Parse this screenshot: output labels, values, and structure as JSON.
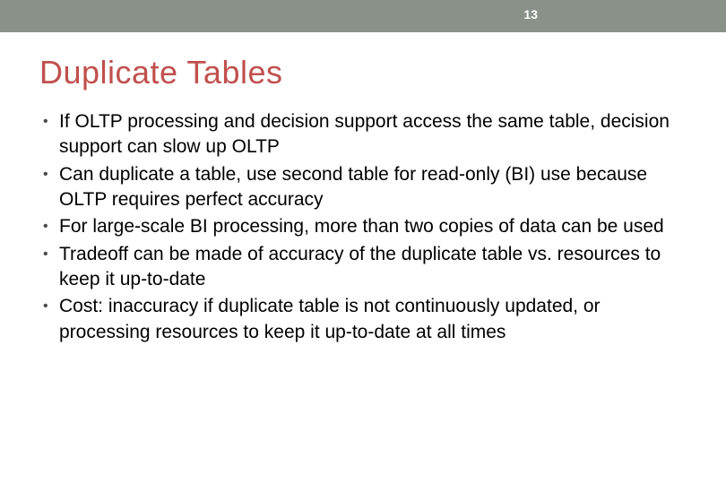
{
  "header": {
    "page_number": "13"
  },
  "slide": {
    "title": "Duplicate Tables",
    "bullets": [
      "If OLTP processing and decision support access the same table, decision support can slow up OLTP",
      "Can duplicate a table, use second table for read-only (BI) use because OLTP requires perfect accuracy",
      "For large-scale BI processing, more than two copies of data can be used",
      "Tradeoff can be made of accuracy of the duplicate table vs. resources to keep it up-to-date",
      "Cost:  inaccuracy if duplicate table is not continuously updated, or processing resources to keep it up-to-date at all times"
    ]
  }
}
